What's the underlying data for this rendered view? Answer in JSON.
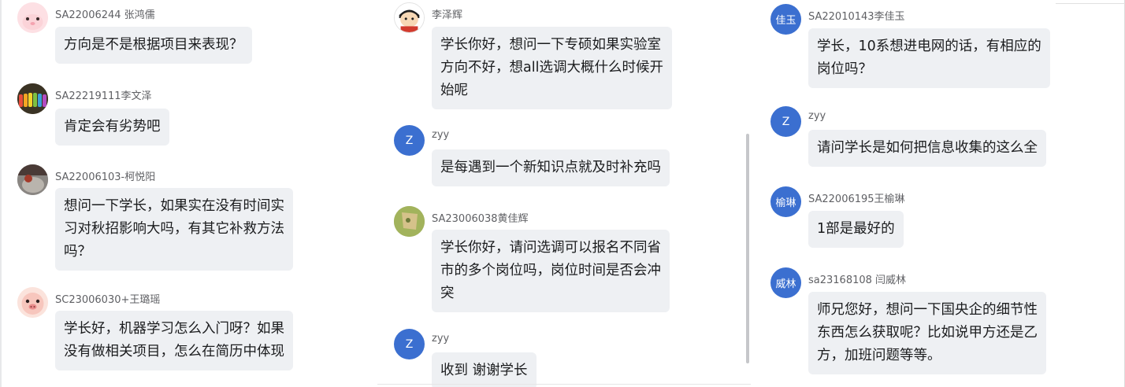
{
  "left_column": {
    "messages": [
      {
        "sender": "SA22006244 张鸿儒",
        "text": "方向是不是根据项目来表现？",
        "avatar": "pink-cartoon-avatar"
      },
      {
        "sender": "SA22219111李文泽",
        "text": "肯定会有劣势吧",
        "avatar": "colorful-photo-avatar"
      },
      {
        "sender": "SA22006103-柯悦阳",
        "text": "想问一下学长，如果实在没有时间实\n习对秋招影响大吗，有其它补救方法\n吗？",
        "avatar": "photo-avatar"
      },
      {
        "sender": "SC23006030+王璐瑶",
        "text": "学长好，机器学习怎么入门呀？如果\n没有做相关项目，怎么在简历中体现",
        "avatar": "pig-cartoon-avatar"
      }
    ]
  },
  "middle_column": {
    "messages": [
      {
        "sender": "李泽辉",
        "text": "学长你好，想问一下专硕如果实验室\n方向不好，想all选调大概什么时候开\n始呢",
        "avatar": "cartoon-boy-avatar"
      },
      {
        "sender": "zyy",
        "text": "是每遇到一个新知识点就及时补充吗",
        "avatar_text": "Z"
      },
      {
        "sender": "SA23006038黄佳辉",
        "text": "学长你好，请问选调可以报名不同省\n市的多个岗位吗，岗位时间是否会冲\n突",
        "avatar": "green-photo-avatar"
      },
      {
        "sender": "zyy",
        "text": "收到 谢谢学长",
        "avatar_text": "Z"
      }
    ]
  },
  "right_column": {
    "messages": [
      {
        "sender": "SA22010143李佳玉",
        "text": "学长，10系想进电网的话，有相应的\n岗位吗？",
        "avatar_text": "佳玉"
      },
      {
        "sender": "zyy",
        "text": "请问学长是如何把信息收集的这么全",
        "avatar_text": "Z"
      },
      {
        "sender": "SA22006195王榆琳",
        "text": "1部是最好的",
        "avatar_text": "榆琳"
      },
      {
        "sender": "sa23168108 闫威林",
        "text": "师兄您好，想问一下国央企的细节性\n东西怎么获取呢？比如说甲方还是乙\n方，加班问题等等。",
        "avatar_text": "威林"
      }
    ]
  },
  "colors": {
    "bubble": "#eef0f3",
    "avatar_blue": "#3b6fd0",
    "sender_text": "#5f6064"
  }
}
